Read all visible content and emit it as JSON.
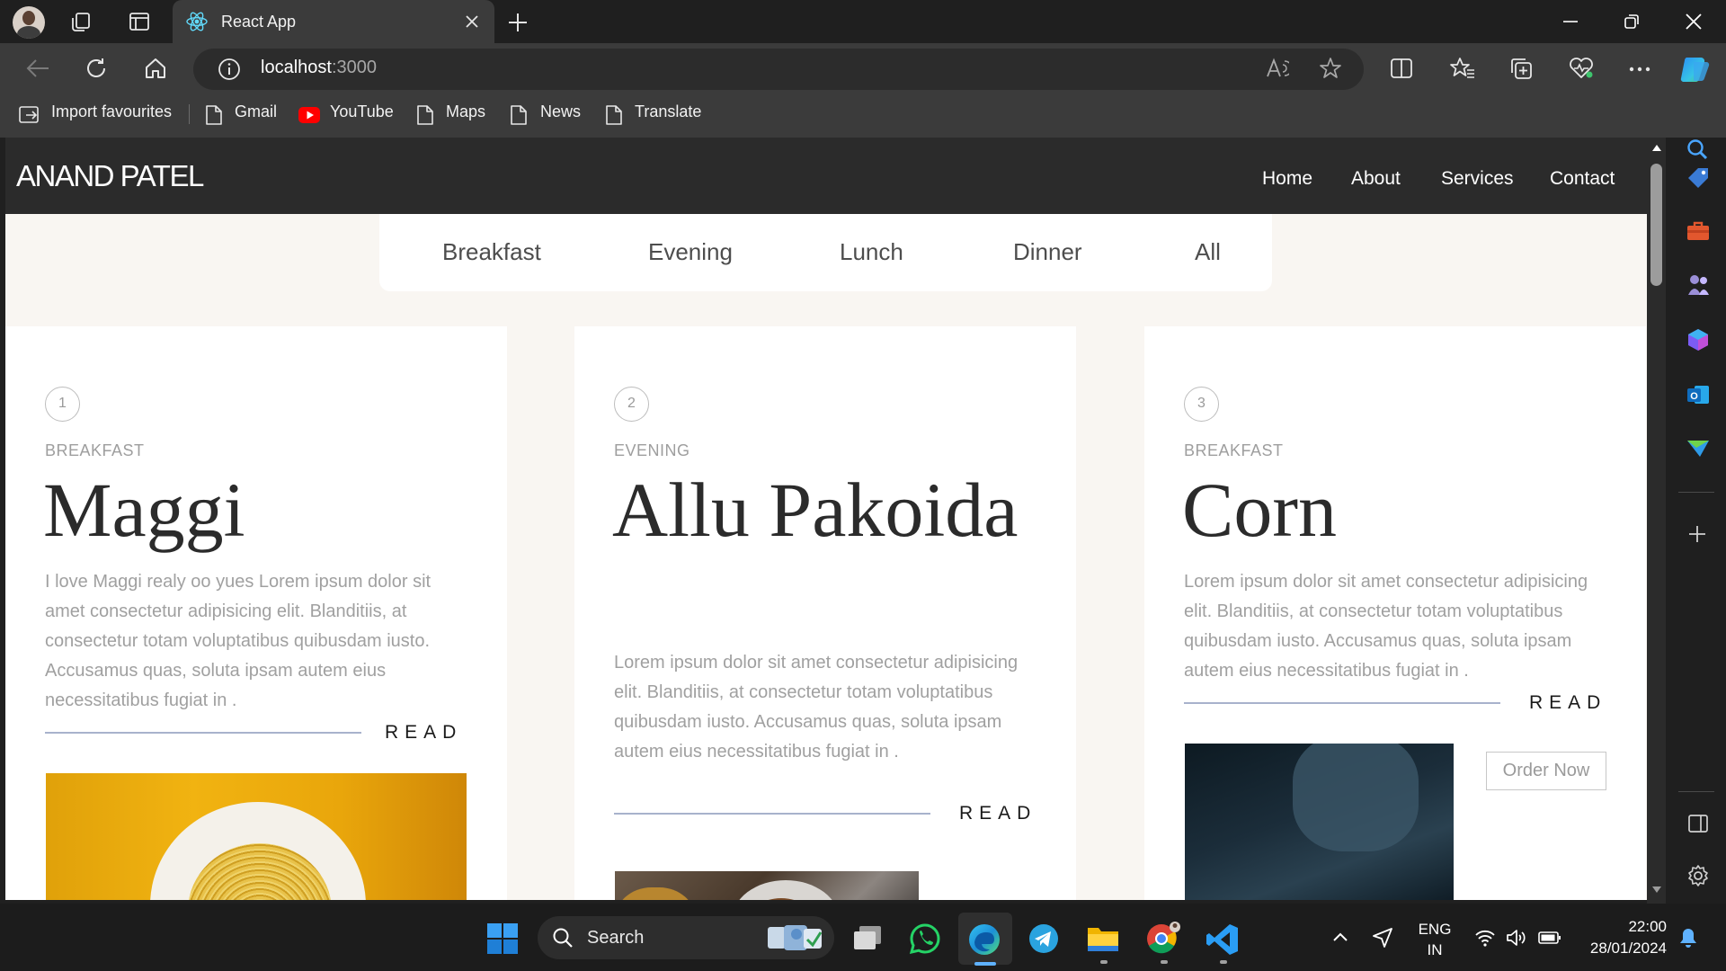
{
  "browser": {
    "tab_title": "React App",
    "url_host": "localhost",
    "url_port": ":3000",
    "favourites": [
      "Import favourites",
      "Gmail",
      "YouTube",
      "Maps",
      "News",
      "Translate"
    ]
  },
  "site": {
    "logo": "ANAND PATEL",
    "nav": [
      "Home",
      "About",
      "Services",
      "Contact"
    ]
  },
  "filter_tabs": [
    "Breakfast",
    "Evening",
    "Lunch",
    "Dinner",
    "All"
  ],
  "cards": [
    {
      "number": "1",
      "category": "BREAKFAST",
      "title": "Maggi",
      "description": "I love Maggi realy oo yues Lorem ipsum dolor sit amet consectetur adipisicing elit. Blanditiis, at consectetur totam voluptatibus quibusdam iusto. Accusamus quas, soluta ipsam autem eius necessitatibus fugiat in .",
      "read_label": "READ"
    },
    {
      "number": "2",
      "category": "EVENING",
      "title": "Allu Pakoida",
      "description": "Lorem ipsum dolor sit amet consectetur adipisicing elit. Blanditiis, at consectetur totam voluptatibus quibusdam iusto. Accusamus quas, soluta ipsam autem eius necessitatibus fugiat in .",
      "read_label": "READ"
    },
    {
      "number": "3",
      "category": "BREAKFAST",
      "title": "Corn",
      "description": "Lorem ipsum dolor sit amet consectetur adipisicing elit. Blanditiis, at consectetur totam voluptatibus quibusdam iusto. Accusamus quas, soluta ipsam autem eius necessitatibus fugiat in .",
      "read_label": "READ",
      "button_label": "Order Now"
    }
  ],
  "taskbar": {
    "search_label": "Search",
    "language": "ENG",
    "region": "IN",
    "time": "22:00",
    "date": "28/01/2024"
  },
  "colors": {
    "page_background": "#f9f6f2",
    "site_header": "#2b2b2b",
    "read_rule": "#a8b2cc",
    "taskbar": "#1c1c1c"
  }
}
